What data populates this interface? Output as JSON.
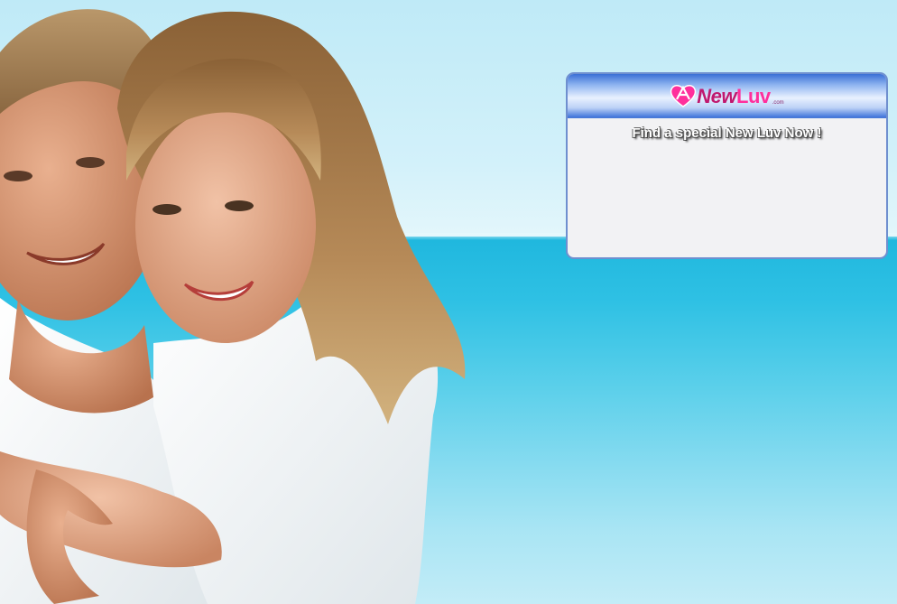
{
  "brand": {
    "logo_name_part1": "New",
    "logo_name_part2": "Luv",
    "logo_suffix": ".com",
    "primary_color": "#ff2f9c",
    "secondary_color": "#c0186f"
  },
  "panel": {
    "tagline": "Find a special New Luv Now !",
    "header_color": "#3a6fd6",
    "body_color": "#f2f2f4"
  },
  "background": {
    "sky_color": "#cfeff9",
    "sea_color": "#2fc1e4"
  }
}
